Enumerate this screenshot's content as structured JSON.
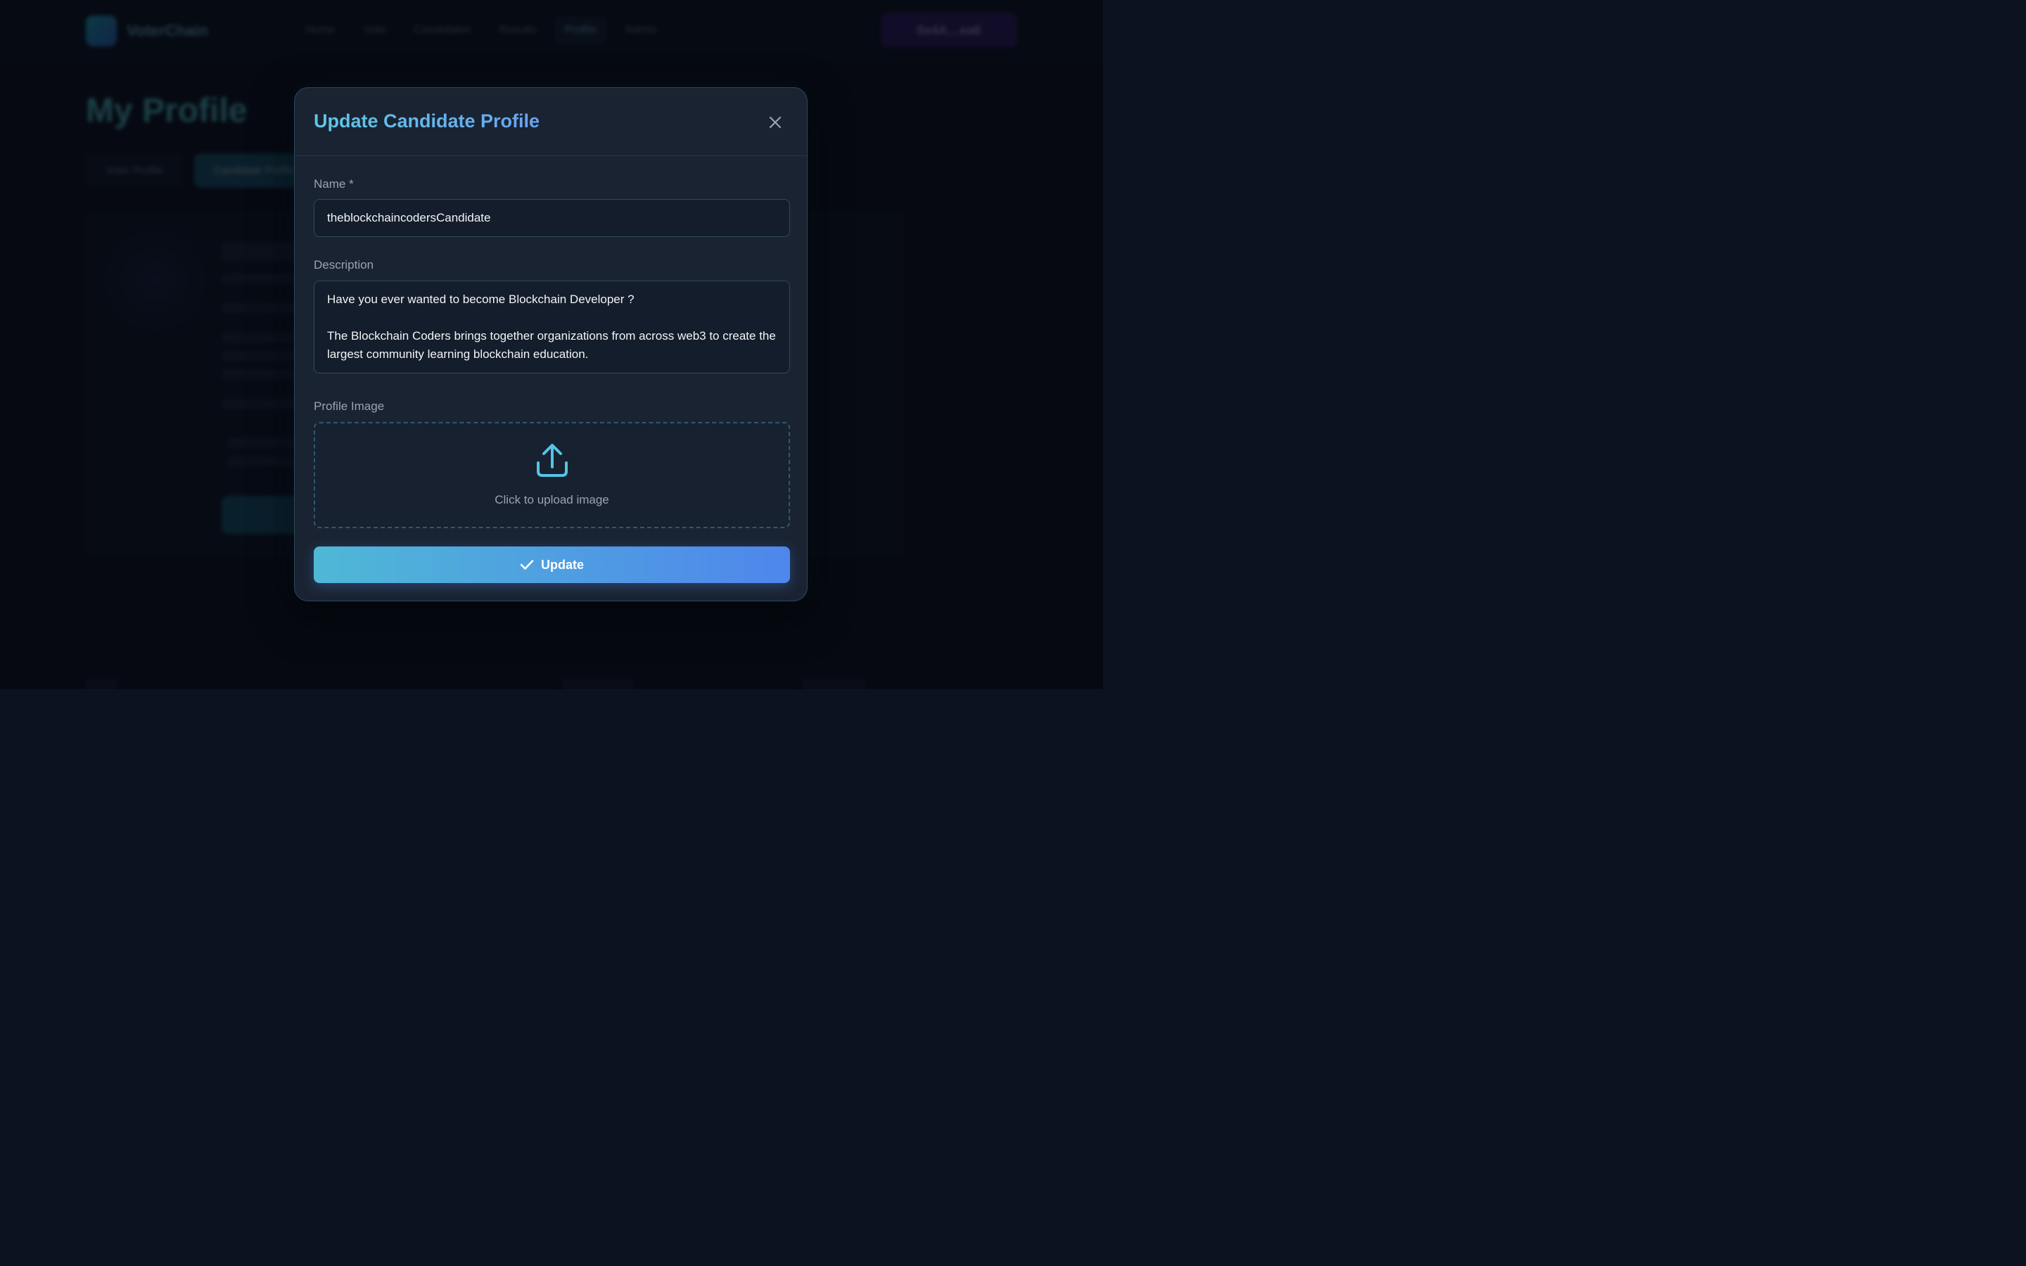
{
  "background": {
    "brand": "VoterChain",
    "nav": [
      "Home",
      "Vote",
      "Candidates",
      "Results",
      "Profile",
      "Admin"
    ],
    "wallet_button": "0x4A…ea6",
    "page_title": "My Profile",
    "tabs": [
      "Voter Profile",
      "Candidate Profile"
    ]
  },
  "modal": {
    "title": "Update Candidate Profile",
    "close_icon": "close-icon",
    "name_label": "Name *",
    "name_value": "theblockchaincodersCandidate",
    "description_label": "Description",
    "description_line1": "Have you ever wanted to become Blockchain Developer ?",
    "description_line2": "The Blockchain Coders brings together organizations from across web3 to create the largest community learning blockchain education.",
    "image_label": "Profile Image",
    "upload_icon": "upload-icon",
    "upload_text": "Click to upload image",
    "update_label": "Update",
    "update_icon": "check-icon"
  },
  "colors": {
    "title_gradient": [
      "#5ec8e6",
      "#6aa4f0"
    ],
    "button_gradient": [
      "#4fb8d6",
      "#4f86ec"
    ],
    "modal_bg": "#1a2332",
    "accent": "#5ec8e6"
  }
}
